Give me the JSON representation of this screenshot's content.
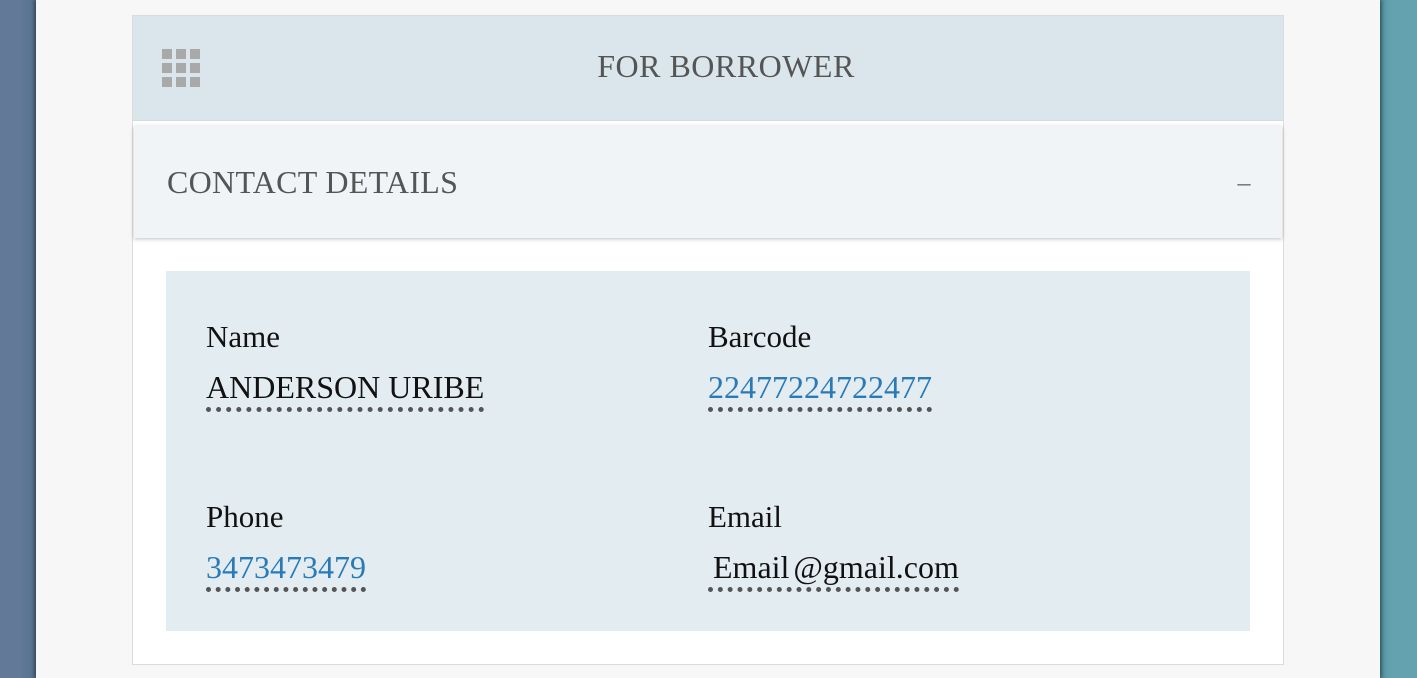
{
  "header": {
    "title": "FOR BORROWER",
    "icon": "grid-icon"
  },
  "section": {
    "title": "CONTACT DETAILS",
    "collapse_label": "–"
  },
  "contact": {
    "name": {
      "label": "Name",
      "value": "ANDERSON URIBE"
    },
    "barcode": {
      "label": "Barcode",
      "value": "22477224722477"
    },
    "phone": {
      "label": "Phone",
      "value": "3473473479"
    },
    "email": {
      "label": "Email",
      "user": "Email",
      "domain": "@gmail.com"
    }
  },
  "colors": {
    "header_bg": "#dae6eb",
    "section_bg": "#f1f4f7",
    "panel_bg": "#e2ecf1",
    "link": "#2a7ab8"
  }
}
